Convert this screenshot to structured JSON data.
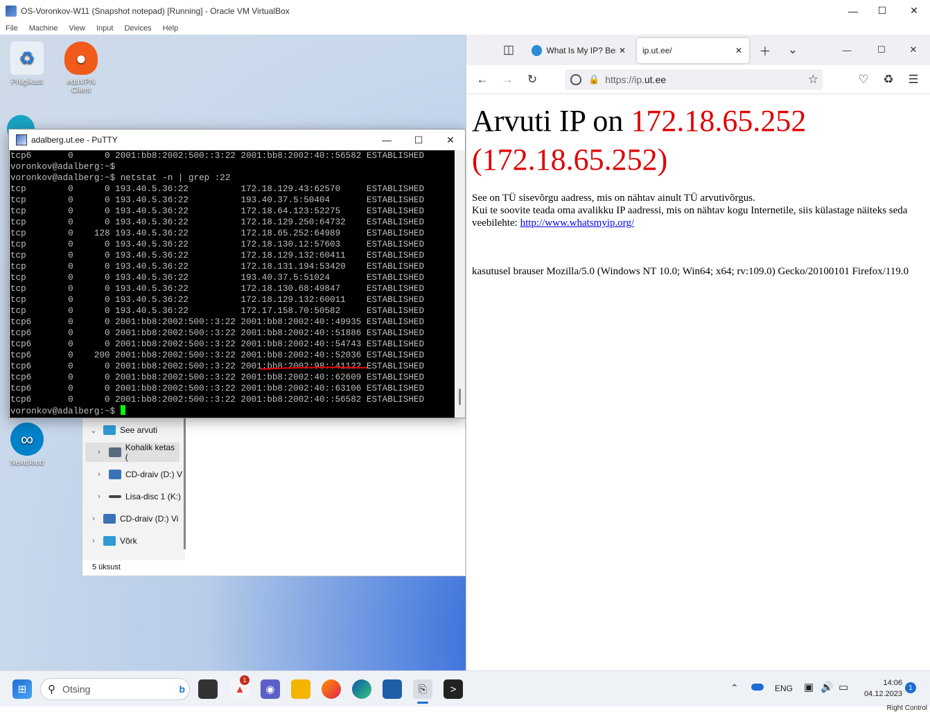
{
  "vbox": {
    "title": "OS-Voronkov-W11 (Snapshot notepad) [Running] - Oracle VM VirtualBox",
    "menu": [
      "File",
      "Machine",
      "View",
      "Input",
      "Devices",
      "Help"
    ],
    "status_text": "Right Control"
  },
  "desktop": {
    "icons": [
      {
        "label": "Prügikast"
      },
      {
        "label": "eduVPN Client"
      },
      {
        "label": "Nextcloud"
      }
    ]
  },
  "explorer": {
    "tree": [
      {
        "label": "See arvuti",
        "expanded": true
      },
      {
        "label": "Kohalik ketas ("
      },
      {
        "label": "CD-draiv (D:) V"
      },
      {
        "label": "Lisa-disc 1 (K:)"
      },
      {
        "label": "CD-draiv (D:) Vi"
      },
      {
        "label": "Võrk"
      }
    ],
    "status": "5 üksust"
  },
  "putty": {
    "title": "adalberg.ut.ee - PuTTY",
    "lines": [
      "tcp6       0      0 2001:bb8:2002:500::3:22 2001:bb8:2002:40::56582 ESTABLISHED",
      "voronkov@adalberg:~$",
      "voronkov@adalberg:~$ netstat -n | grep :22",
      "tcp        0      0 193.40.5.36:22          172.18.129.43:62570     ESTABLISHED",
      "tcp        0      0 193.40.5.36:22          193.40.37.5:50404       ESTABLISHED",
      "tcp        0      0 193.40.5.36:22          172.18.64.123:52275     ESTABLISHED",
      "tcp        0      0 193.40.5.36:22          172.18.129.250:64732    ESTABLISHED",
      "tcp        0    128 193.40.5.36:22          172.18.65.252:64989     ESTABLISHED",
      "tcp        0      0 193.40.5.36:22          172.18.130.12:57603     ESTABLISHED",
      "tcp        0      0 193.40.5.36:22          172.18.129.132:60411    ESTABLISHED",
      "tcp        0      0 193.40.5.36:22          172.18.131.194:53420    ESTABLISHED",
      "tcp        0      0 193.40.5.36:22          193.40.37.5:51024       ESTABLISHED",
      "tcp        0      0 193.40.5.36:22          172.18.130.68:49847     ESTABLISHED",
      "tcp        0      0 193.40.5.36:22          172.18.129.132:60011    ESTABLISHED",
      "tcp        0      0 193.40.5.36:22          172.17.158.70:50582     ESTABLISHED",
      "tcp6       0      0 2001:bb8:2002:500::3:22 2001:bb8:2002:40::49935 ESTABLISHED",
      "tcp6       0      0 2001:bb8:2002:500::3:22 2001:bb8:2002:40::51886 ESTABLISHED",
      "tcp6       0      0 2001:bb8:2002:500::3:22 2001:bb8:2002:40::54743 ESTABLISHED",
      "tcp6       0    200 2001:bb8:2002:500::3:22 2001:bb8:2002:40::52036 ESTABLISHED",
      "tcp6       0      0 2001:bb8:2002:500::3:22 2001:bb8:2002:98::41122 ESTABLISHED",
      "tcp6       0      0 2001:bb8:2002:500::3:22 2001:bb8:2002:40::62609 ESTABLISHED",
      "tcp6       0      0 2001:bb8:2002:500::3:22 2001:bb8:2002:40::63106 ESTABLISHED",
      "tcp6       0      0 2001:bb8:2002:500::3:22 2001:bb8:2002:40::56582 ESTABLISHED"
    ],
    "prompt": "voronkov@adalberg:~$ ",
    "highlight_color": "#e00000"
  },
  "firefox": {
    "tabs": [
      {
        "label": "What Is My IP? Best",
        "active": false
      },
      {
        "label": "ip.ut.ee/",
        "active": true
      }
    ],
    "url_prefix": "https://ip.",
    "url_domain": "ut.ee",
    "page": {
      "heading_prefix": "Arvuti IP on ",
      "ip": "172.18.65.252",
      "ip_paren": "(172.18.65.252)",
      "line1": "See on TÜ sisevõrgu aadress, mis on nähtav ainult TÜ arvutivõrgus.",
      "line2": "Kui te soovite teada oma avalikku IP aadressi, mis on nähtav kogu Internetile, siis külastage näiteks seda veebilehte: ",
      "link": "http://www.whatsmyip.org/",
      "ua": "kasutusel brauser Mozilla/5.0 (Windows NT 10.0; Win64; x64; rv:109.0) Gecko/20100101 Firefox/119.0",
      "accent": "#e00000"
    }
  },
  "taskbar": {
    "search_placeholder": "Otsing",
    "notification_badge": "1",
    "lang": "ENG",
    "time": "14:06",
    "date": "04.12.2023",
    "notif_count": "1"
  }
}
